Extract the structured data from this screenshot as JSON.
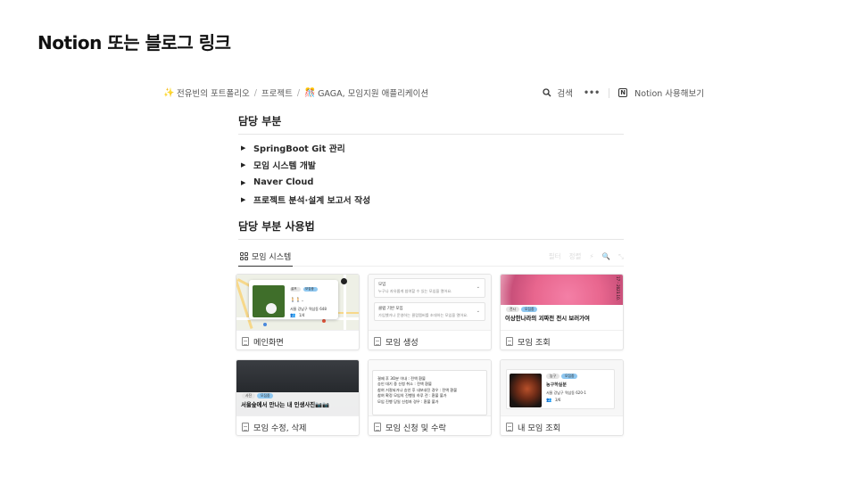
{
  "slide": {
    "title": "Notion 또는 블로그 링크"
  },
  "topbar": {
    "crumbs": [
      {
        "icon": "✨",
        "label": "전유빈의 포트폴리오"
      },
      {
        "icon": "",
        "label": "프로젝트"
      },
      {
        "icon": "🎊",
        "label": "GAGA, 모임지원 애플리케이션"
      }
    ],
    "separator": "/",
    "search_label": "검색",
    "more_label": "•••",
    "notion_label": "Notion 사용해보기"
  },
  "section1": {
    "heading": "담당 부분",
    "items": [
      "SpringBoot Git 관리",
      "모임 시스템 개발",
      "Naver Cloud",
      "프로젝트 분석·설계 보고서 작성"
    ]
  },
  "section2": {
    "heading": "담당 부분 사용법"
  },
  "view": {
    "tab_label": "모임 시스템",
    "tools": [
      "필터",
      "정렬",
      "⚡",
      "🔍",
      "⤡"
    ]
  },
  "cards": [
    {
      "caption": "메인화면"
    },
    {
      "caption": "모임 생성"
    },
    {
      "caption": "모임 조회"
    },
    {
      "caption": "모임 수정, 삭제"
    },
    {
      "caption": "모임 신청 및 수락"
    },
    {
      "caption": "내 모임 조회"
    }
  ],
  "thumbs": {
    "map": {
      "popup_tags": [
        "골프",
        "모집중"
      ],
      "addr": "서울 강남구 역삼동 648",
      "count": "1/4"
    },
    "form": {
      "box1_title": "모임",
      "box1_desc": "누구나 자유롭게 참여할 수 있는 모임을 열어요.",
      "box2_title": "클럽 기반 모임",
      "box2_desc": "가입했거나 운영하는 클럽멤버를 초대하는 모임을 열어요."
    },
    "pink": {
      "tags": [
        "전시",
        "모집중"
      ],
      "title": "이상한나라의 괴짜전 전시 보러가여",
      "vertical": "17 - 2023.10."
    },
    "dark": {
      "tags": [
        "사진",
        "모집중"
      ],
      "title": "서울숲에서 만나는 내 인생사진📷📷"
    },
    "list": {
      "lines": [
        "결제 후 3O분 이내 : 전액 환불",
        "승인 대기 중 신청 취소 : 전액 환불",
        "참여 거절되거나 승인 후 내보내진 경우 : 전액 환불",
        "참여 확정 모임의 진행일 하루 전 : 환불 불가",
        "모임 진행 당일 신청자 경우 : 환불 불가"
      ]
    },
    "basketball": {
      "tags": [
        "농구",
        "모집중"
      ],
      "title": "농구하실분",
      "addr": "서울 강남구 역삼동 620-1",
      "count": "3/6"
    }
  },
  "colors": {
    "accent_blue": "#8ec7f0",
    "tag_grey": "#e4e4e4",
    "pink": "#e8668e"
  }
}
